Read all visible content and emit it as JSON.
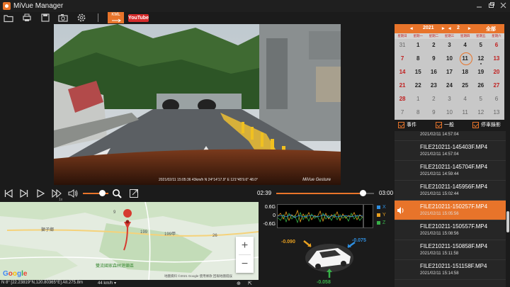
{
  "app": {
    "title": "MiVue Manager"
  },
  "toolbar": {
    "kml_label": "KML",
    "youtube_label": "YouTube"
  },
  "video": {
    "timestamp": "2021/02/11 15:05:36 43km/h N 24°14'17.9\" E 121°45'9.6\" 48.0°",
    "brand": "MiVue Gesture"
  },
  "player": {
    "current_time": "02:39",
    "end_time": "03:00",
    "progress": 0.883,
    "volume": 0.65,
    "speed_label": "1x"
  },
  "map": {
    "labels": {
      "village": "獅子鄉",
      "park": "雙流國家森林遊樂區",
      "road1": "9",
      "road2": "199",
      "road3": "199甲",
      "road4": "26"
    },
    "google": "Google",
    "credit": "地圖資料 ©2021 Google   使用條款   回報地圖錯誤",
    "zoom_in": "+",
    "zoom_out": "−"
  },
  "status": {
    "coord": "N 8° [22.23819°N,120.80365°E] Alt.275.8m",
    "speed": "44  km/h ▾"
  },
  "gsensor": {
    "labels": [
      "0.6G",
      "0",
      "-0.6G"
    ],
    "legend": [
      {
        "label": "X",
        "color": "#2f8fe0"
      },
      {
        "label": "Y",
        "color": "#e8a020"
      },
      {
        "label": "Z",
        "color": "#38b048"
      }
    ],
    "values": {
      "left": "-0.090",
      "right": "-0.075",
      "bottom": "-0.058"
    }
  },
  "calendar": {
    "year": "2021",
    "month": "2",
    "filter_label": "全部",
    "weekdays": [
      "星期日",
      "星期一",
      "星期二",
      "星期三",
      "星期四",
      "星期五",
      "星期六"
    ],
    "days": [
      {
        "d": "31",
        "dim": true
      },
      {
        "d": "1"
      },
      {
        "d": "2"
      },
      {
        "d": "3"
      },
      {
        "d": "4"
      },
      {
        "d": "5"
      },
      {
        "d": "6",
        "red": true
      },
      {
        "d": "7",
        "red": true
      },
      {
        "d": "8"
      },
      {
        "d": "9"
      },
      {
        "d": "10"
      },
      {
        "d": "11",
        "sel": true
      },
      {
        "d": "12",
        "dot": true
      },
      {
        "d": "13",
        "red": true
      },
      {
        "d": "14",
        "red": true
      },
      {
        "d": "15"
      },
      {
        "d": "16"
      },
      {
        "d": "17"
      },
      {
        "d": "18"
      },
      {
        "d": "19"
      },
      {
        "d": "20",
        "red": true
      },
      {
        "d": "21",
        "red": true
      },
      {
        "d": "22"
      },
      {
        "d": "23"
      },
      {
        "d": "24"
      },
      {
        "d": "25"
      },
      {
        "d": "26"
      },
      {
        "d": "27",
        "red": true
      },
      {
        "d": "28",
        "red": true
      },
      {
        "d": "1",
        "dim": true
      },
      {
        "d": "2",
        "dim": true
      },
      {
        "d": "3",
        "dim": true
      },
      {
        "d": "4",
        "dim": true
      },
      {
        "d": "5",
        "dim": true
      },
      {
        "d": "6",
        "dim": true
      },
      {
        "d": "7",
        "dim": true
      },
      {
        "d": "8",
        "dim": true
      },
      {
        "d": "9",
        "dim": true
      },
      {
        "d": "10",
        "dim": true
      },
      {
        "d": "11",
        "dim": true
      },
      {
        "d": "12",
        "dim": true
      },
      {
        "d": "13",
        "dim": true
      }
    ]
  },
  "filters": [
    {
      "label": "事件"
    },
    {
      "label": "一般"
    },
    {
      "label": "停車錄影"
    }
  ],
  "files": [
    {
      "name": "",
      "date": "2021/02/11   14:57:04"
    },
    {
      "name": "FILE210211-145403F.MP4",
      "date": "2021/02/11   14:57:04"
    },
    {
      "name": "FILE210211-145704F.MP4",
      "date": "2021/02/11   14:59:44"
    },
    {
      "name": "FILE210211-145956F.MP4",
      "date": "2021/02/11   15:02:44"
    },
    {
      "name": "FILE210211-150257F.MP4",
      "date": "2021/02/11   15:05:56",
      "active": true
    },
    {
      "name": "FILE210211-150557F.MP4",
      "date": "2021/02/11   15:08:56"
    },
    {
      "name": "FILE210211-150858F.MP4",
      "date": "2021/02/11   15:11:58"
    },
    {
      "name": "FILE210211-151158F.MP4",
      "date": "2021/02/11   15:14:58"
    }
  ]
}
